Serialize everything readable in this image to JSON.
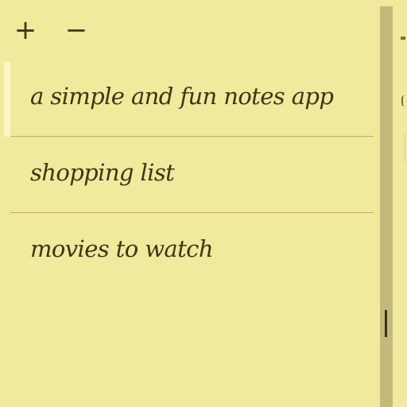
{
  "toolbar": {
    "add_label": "+",
    "remove_label": "−"
  },
  "notes": [
    {
      "title": "a simple and fun notes app",
      "selected": true
    },
    {
      "title": "shopping list",
      "selected": false
    },
    {
      "title": "movies to watch",
      "selected": false
    }
  ],
  "colors": {
    "background": "#f1e99b",
    "text": "#3b3516",
    "divider": "#c4b97b",
    "selection": "#fbf5c8"
  }
}
